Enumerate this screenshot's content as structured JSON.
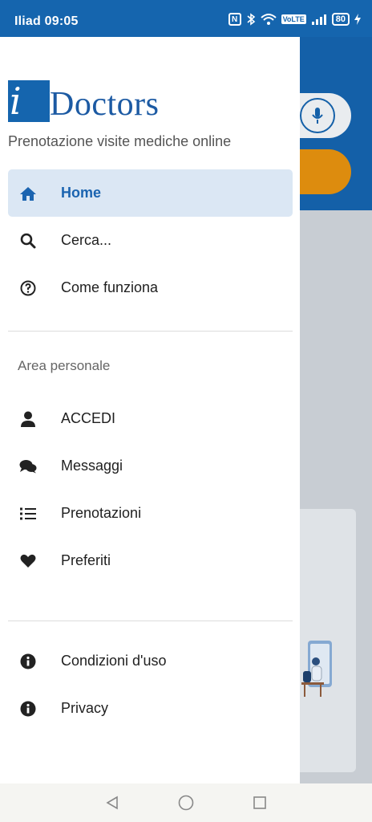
{
  "status_bar": {
    "carrier": "Iliad",
    "time": "09:05",
    "volte": "VoLTE",
    "battery": "80"
  },
  "drawer": {
    "logo_i": "i",
    "logo_rest": "Doctors",
    "tagline": "Prenotazione visite mediche online",
    "main_menu": [
      {
        "label": "Home",
        "icon": "home-icon",
        "active": true
      },
      {
        "label": "Cerca...",
        "icon": "search-icon"
      },
      {
        "label": "Come funziona",
        "icon": "question-circle-icon"
      }
    ],
    "section_title": "Area personale",
    "personal_menu": [
      {
        "label": "ACCEDI",
        "icon": "user-icon"
      },
      {
        "label": "Messaggi",
        "icon": "chat-bubbles-icon"
      },
      {
        "label": "Prenotazioni",
        "icon": "list-icon"
      },
      {
        "label": "Preferiti",
        "icon": "heart-icon"
      }
    ],
    "footer_menu": [
      {
        "label": "Condizioni d'uso",
        "icon": "info-circle-icon"
      },
      {
        "label": "Privacy",
        "icon": "info-circle-icon"
      }
    ]
  },
  "colors": {
    "brand_blue": "#1565ae",
    "active_bg": "#dbe7f4",
    "accent_orange": "#dd8c0e"
  }
}
